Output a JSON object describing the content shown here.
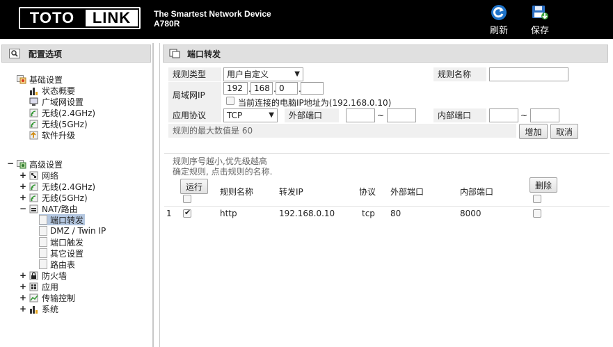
{
  "header": {
    "logo_left": "TOTO",
    "logo_right": "LINK",
    "slogan": "The Smartest Network Device",
    "model": "A780R",
    "refresh_label": "刷新",
    "save_label": "保存"
  },
  "sidebar": {
    "title": "配置选项",
    "basic": {
      "label": "基础设置",
      "items": [
        "状态概要",
        "广域网设置",
        "无线(2.4GHz)",
        "无线(5GHz)",
        "软件升级"
      ]
    },
    "advanced": {
      "label": "高级设置",
      "items": {
        "network": "网络",
        "wifi24": "无线(2.4GHz)",
        "wifi5": "无线(5GHz)",
        "nat": "NAT/路由",
        "nat_children": [
          "端口转发",
          "DMZ / Twin IP",
          "端口触发",
          "其它设置",
          "路由表"
        ],
        "firewall": "防火墙",
        "apps": "应用",
        "traffic": "传输控制",
        "system": "系统"
      },
      "selected": "端口转发"
    }
  },
  "main": {
    "title": "端口转发",
    "form": {
      "rule_type_label": "规则类型",
      "rule_type_value": "用户自定义",
      "rule_name_label": "规则名称",
      "rule_name_value": "",
      "lan_ip_label": "局域网IP",
      "ip1": "192",
      "ip2": "168",
      "ip3": "0",
      "ip4": "",
      "current_ip_text": "当前连接的电脑IP地址为(192.168.0.10)",
      "protocol_label": "应用协议",
      "protocol_value": "TCP",
      "ext_port_label": "外部端口",
      "ext_port_from": "",
      "ext_port_to": "",
      "int_port_label": "内部端口",
      "int_port_from": "",
      "int_port_to": "",
      "max_rules_text": "规则的最大数值是 60",
      "add_label": "增加",
      "cancel_label": "取消"
    },
    "notes": [
      "规则序号越小,优先级越高",
      "确定规则, 点击规则的名称."
    ],
    "table": {
      "run_label": "运行",
      "delete_label": "删除",
      "columns": [
        "规则名称",
        "转发IP",
        "协议",
        "外部端口",
        "内部端口"
      ],
      "rows": [
        {
          "index": "1",
          "enabled": true,
          "name": "http",
          "ip": "192.168.0.10",
          "protocol": "tcp",
          "ext_port": "80",
          "int_port": "8000",
          "delete": false
        }
      ]
    }
  }
}
